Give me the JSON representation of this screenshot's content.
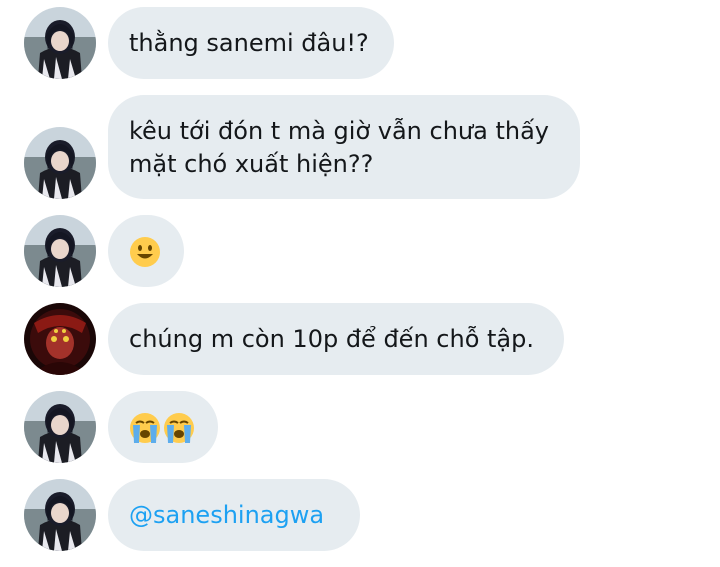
{
  "colors": {
    "bubble_bg": "#e6ecf0",
    "text": "#14171a",
    "mention": "#1da1f2",
    "background": "#ffffff"
  },
  "messages": [
    {
      "sender_avatar": "obanai-avatar",
      "lines": [
        "thằng sanemi đâu!?"
      ]
    },
    {
      "sender_avatar": "obanai-avatar",
      "lines": [
        "kêu tới đón t mà giờ vẫn chưa thấy",
        "mặt chó xuất hiện??"
      ]
    },
    {
      "sender_avatar": "obanai-avatar",
      "emojis": [
        "smiling-face"
      ]
    },
    {
      "sender_avatar": "kokushibo-avatar",
      "lines": [
        "chúng m còn 10p để đến chỗ tập."
      ]
    },
    {
      "sender_avatar": "obanai-avatar",
      "emojis": [
        "loudly-crying-face",
        "loudly-crying-face"
      ]
    },
    {
      "sender_avatar": "obanai-avatar",
      "mention": "@saneshinagwa"
    }
  ]
}
